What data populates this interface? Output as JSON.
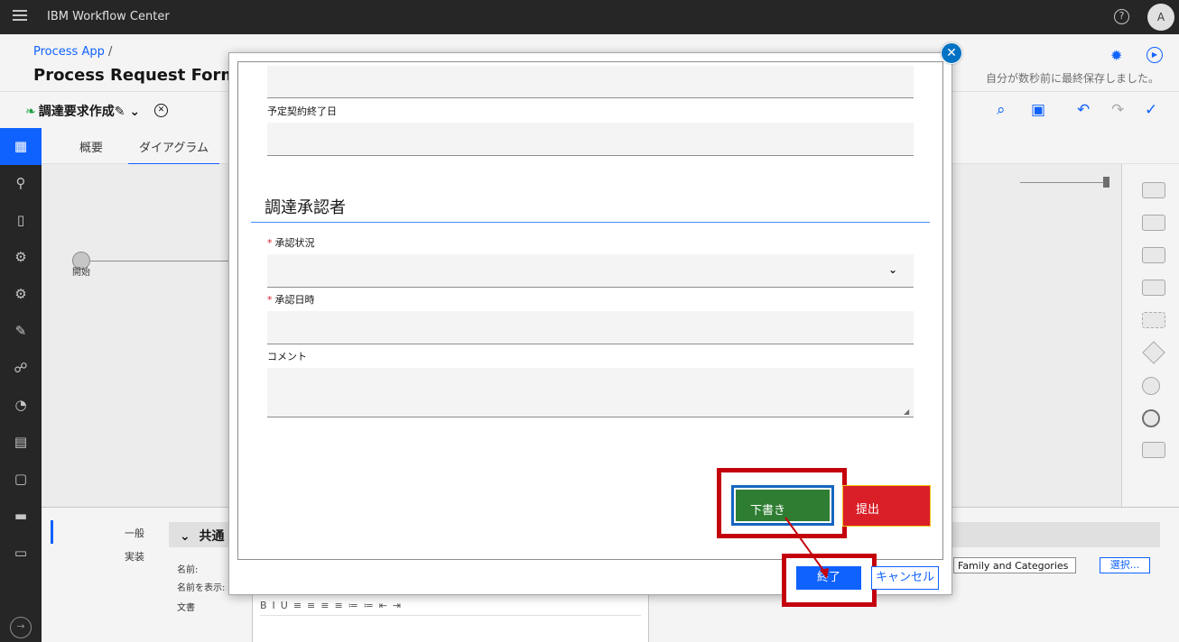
{
  "topbar": {
    "title": "IBM Workflow Center",
    "help": "?",
    "avatar": "A"
  },
  "header": {
    "crumb": "Process App",
    "crumb_sep": " /",
    "title": "Process Request Form R",
    "save_status": "自分が数秒前に最終保存しました。"
  },
  "toolbar": {
    "process_name": "調達要求作成✎",
    "chevron": "⌄"
  },
  "tabs": [
    "概要",
    "ダイアグラム"
  ],
  "canvas": {
    "start_label": "開始"
  },
  "props": {
    "tabs": [
      "一般",
      "実装"
    ],
    "section": "共通",
    "labels": [
      "名前:",
      "名前を表示:",
      "文書"
    ],
    "rte_toolbar": "BIU≡≡≡≡≔≔⇤⇥",
    "family_value": "Family and Categories",
    "choose": "選択..."
  },
  "form": {
    "label_end_date": "予定契約終了日",
    "section_title": "調達承認者",
    "req": "*",
    "label_status": "承認状況",
    "label_datetime": "承認日時",
    "label_comment": "コメント"
  },
  "buttons": {
    "draft": "下書き",
    "submit": "提出",
    "finish": "終了",
    "cancel": "キャンセル"
  },
  "colors": {
    "accent": "#0f62fe",
    "draft": "#2e7d32",
    "submit": "#da1e28",
    "highlight": "#c4000d"
  }
}
